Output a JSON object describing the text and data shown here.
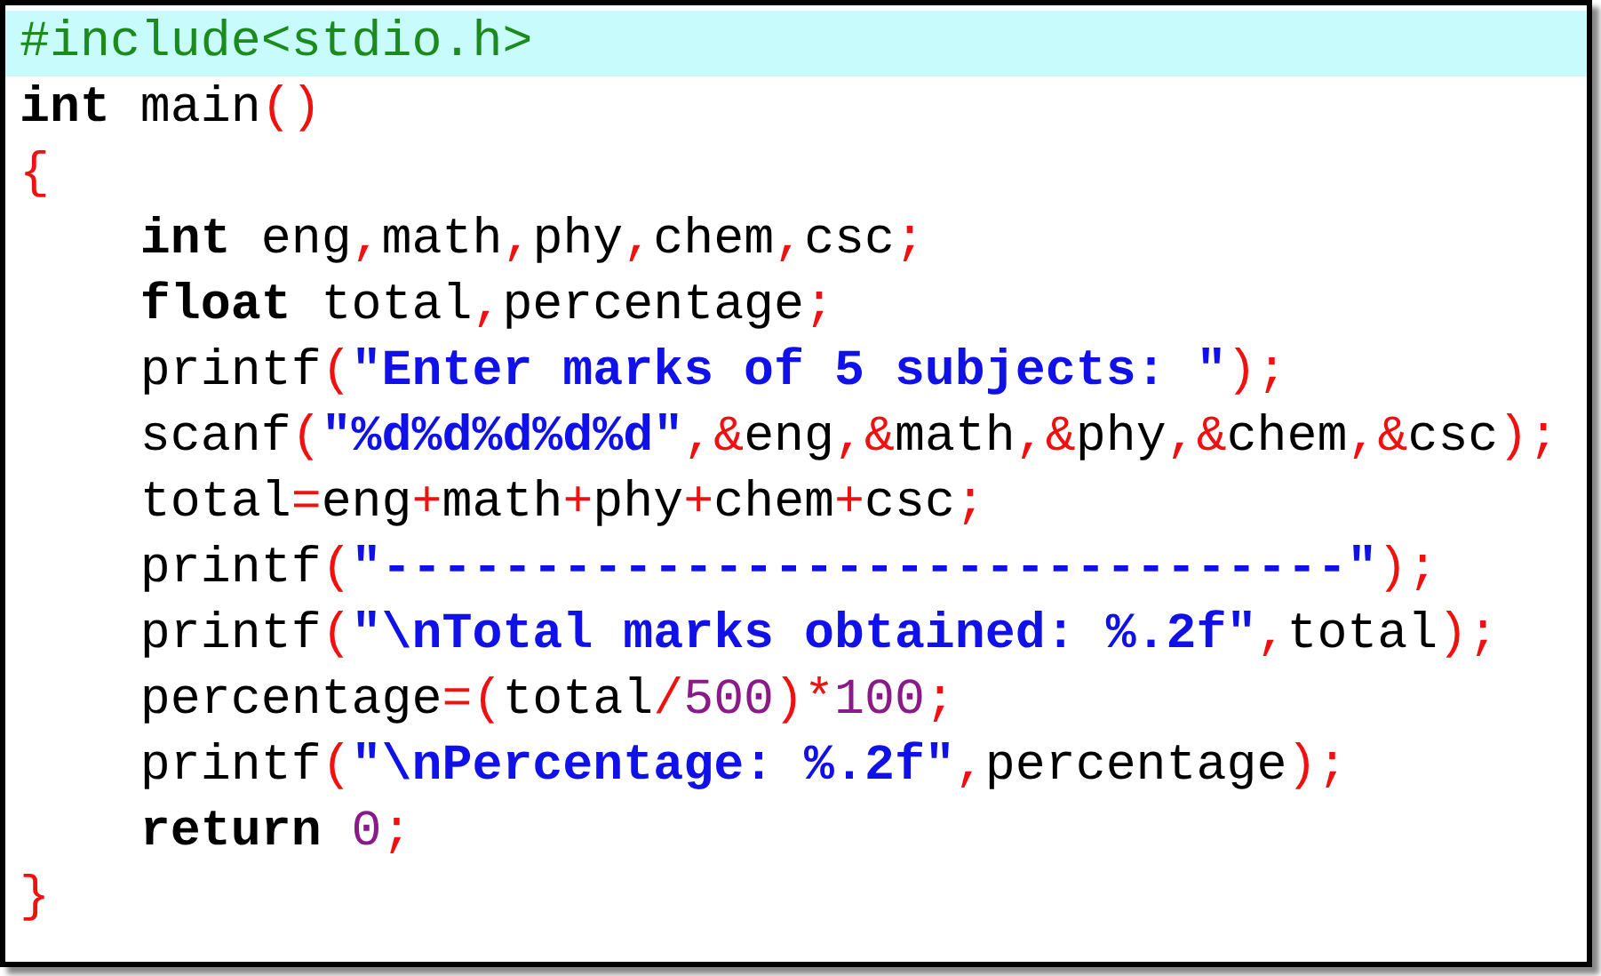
{
  "editor": {
    "lines": [
      {
        "current": true,
        "tokens": [
          {
            "t": "#include<stdio.h>",
            "kind": "preprocessor"
          }
        ]
      },
      {
        "current": false,
        "tokens": [
          {
            "t": "int",
            "kind": "keyword"
          },
          {
            "t": " main",
            "kind": "plain"
          },
          {
            "t": "()",
            "kind": "operator"
          }
        ]
      },
      {
        "current": false,
        "tokens": [
          {
            "t": "{",
            "kind": "operator"
          }
        ]
      },
      {
        "current": false,
        "tokens": [
          {
            "t": "    int",
            "kind": "keyword"
          },
          {
            "t": " eng",
            "kind": "plain"
          },
          {
            "t": ",",
            "kind": "operator"
          },
          {
            "t": "math",
            "kind": "plain"
          },
          {
            "t": ",",
            "kind": "operator"
          },
          {
            "t": "phy",
            "kind": "plain"
          },
          {
            "t": ",",
            "kind": "operator"
          },
          {
            "t": "chem",
            "kind": "plain"
          },
          {
            "t": ",",
            "kind": "operator"
          },
          {
            "t": "csc",
            "kind": "plain"
          },
          {
            "t": ";",
            "kind": "operator"
          }
        ]
      },
      {
        "current": false,
        "tokens": [
          {
            "t": "    float",
            "kind": "keyword"
          },
          {
            "t": " total",
            "kind": "plain"
          },
          {
            "t": ",",
            "kind": "operator"
          },
          {
            "t": "percentage",
            "kind": "plain"
          },
          {
            "t": ";",
            "kind": "operator"
          }
        ]
      },
      {
        "current": false,
        "tokens": [
          {
            "t": "    printf",
            "kind": "plain"
          },
          {
            "t": "(",
            "kind": "operator"
          },
          {
            "t": "\"Enter marks of 5 subjects: \"",
            "kind": "string"
          },
          {
            "t": ");",
            "kind": "operator"
          }
        ]
      },
      {
        "current": false,
        "tokens": [
          {
            "t": "    scanf",
            "kind": "plain"
          },
          {
            "t": "(",
            "kind": "operator"
          },
          {
            "t": "\"%d%d%d%d%d\"",
            "kind": "string"
          },
          {
            "t": ",&",
            "kind": "operator"
          },
          {
            "t": "eng",
            "kind": "plain"
          },
          {
            "t": ",&",
            "kind": "operator"
          },
          {
            "t": "math",
            "kind": "plain"
          },
          {
            "t": ",&",
            "kind": "operator"
          },
          {
            "t": "phy",
            "kind": "plain"
          },
          {
            "t": ",&",
            "kind": "operator"
          },
          {
            "t": "chem",
            "kind": "plain"
          },
          {
            "t": ",&",
            "kind": "operator"
          },
          {
            "t": "csc",
            "kind": "plain"
          },
          {
            "t": ");",
            "kind": "operator"
          }
        ]
      },
      {
        "current": false,
        "tokens": [
          {
            "t": "    total",
            "kind": "plain"
          },
          {
            "t": "=",
            "kind": "operator"
          },
          {
            "t": "eng",
            "kind": "plain"
          },
          {
            "t": "+",
            "kind": "operator"
          },
          {
            "t": "math",
            "kind": "plain"
          },
          {
            "t": "+",
            "kind": "operator"
          },
          {
            "t": "phy",
            "kind": "plain"
          },
          {
            "t": "+",
            "kind": "operator"
          },
          {
            "t": "chem",
            "kind": "plain"
          },
          {
            "t": "+",
            "kind": "operator"
          },
          {
            "t": "csc",
            "kind": "plain"
          },
          {
            "t": ";",
            "kind": "operator"
          }
        ]
      },
      {
        "current": false,
        "tokens": [
          {
            "t": "    printf",
            "kind": "plain"
          },
          {
            "t": "(",
            "kind": "operator"
          },
          {
            "t": "\"--------------------------------\"",
            "kind": "string"
          },
          {
            "t": ");",
            "kind": "operator"
          }
        ]
      },
      {
        "current": false,
        "tokens": [
          {
            "t": "    printf",
            "kind": "plain"
          },
          {
            "t": "(",
            "kind": "operator"
          },
          {
            "t": "\"\\nTotal marks obtained: %.2f\"",
            "kind": "string"
          },
          {
            "t": ",",
            "kind": "operator"
          },
          {
            "t": "total",
            "kind": "plain"
          },
          {
            "t": ");",
            "kind": "operator"
          }
        ]
      },
      {
        "current": false,
        "tokens": [
          {
            "t": "    percentage",
            "kind": "plain"
          },
          {
            "t": "=(",
            "kind": "operator"
          },
          {
            "t": "total",
            "kind": "plain"
          },
          {
            "t": "/",
            "kind": "operator"
          },
          {
            "t": "500",
            "kind": "number"
          },
          {
            "t": ")*",
            "kind": "operator"
          },
          {
            "t": "100",
            "kind": "number"
          },
          {
            "t": ";",
            "kind": "operator"
          }
        ]
      },
      {
        "current": false,
        "tokens": [
          {
            "t": "    printf",
            "kind": "plain"
          },
          {
            "t": "(",
            "kind": "operator"
          },
          {
            "t": "\"\\nPercentage: %.2f\"",
            "kind": "string"
          },
          {
            "t": ",",
            "kind": "operator"
          },
          {
            "t": "percentage",
            "kind": "plain"
          },
          {
            "t": ");",
            "kind": "operator"
          }
        ]
      },
      {
        "current": false,
        "tokens": [
          {
            "t": "    return ",
            "kind": "keyword"
          },
          {
            "t": "0",
            "kind": "number"
          },
          {
            "t": ";",
            "kind": "operator"
          }
        ]
      },
      {
        "current": false,
        "tokens": [
          {
            "t": "}",
            "kind": "operator"
          }
        ]
      }
    ]
  }
}
